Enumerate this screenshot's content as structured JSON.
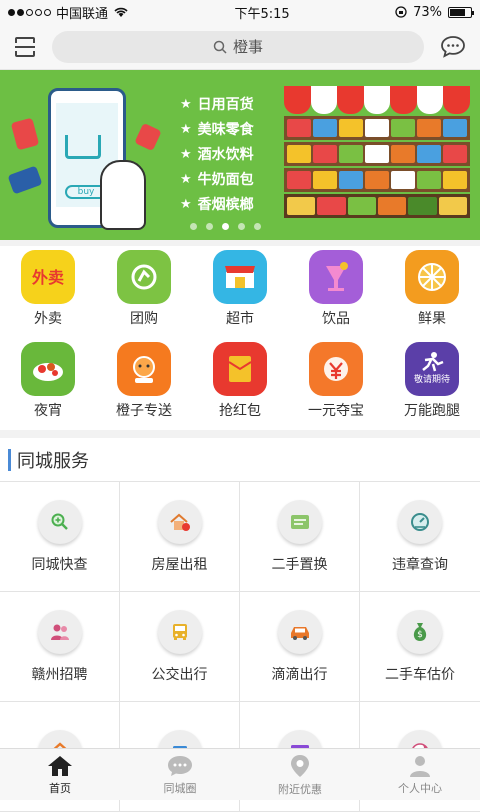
{
  "status": {
    "carrier": "中国联通",
    "time": "下午5:15",
    "battery": "73%"
  },
  "header": {
    "search_placeholder": "橙事"
  },
  "banner": {
    "items": [
      "日用百货",
      "美味零食",
      "酒水饮料",
      "牛奶面包",
      "香烟槟榔"
    ],
    "phone_button": "buy",
    "active_page": 3
  },
  "categories": [
    {
      "label": "外卖",
      "color": "#f6d21b",
      "icon_text": "外卖"
    },
    {
      "label": "团购",
      "color": "#7dc343",
      "icon_text": ""
    },
    {
      "label": "超市",
      "color": "#34b6e4",
      "icon_text": ""
    },
    {
      "label": "饮品",
      "color": "#a45ed8",
      "icon_text": ""
    },
    {
      "label": "鲜果",
      "color": "#f39c1f",
      "icon_text": ""
    },
    {
      "label": "夜宵",
      "color": "#69b83b",
      "icon_text": ""
    },
    {
      "label": "橙子专送",
      "color": "#f57a1f",
      "icon_text": ""
    },
    {
      "label": "抢红包",
      "color": "#e8392f",
      "icon_text": ""
    },
    {
      "label": "一元夺宝",
      "color": "#f4782a",
      "icon_text": ""
    },
    {
      "label": "万能跑腿",
      "color": "#5b3fa8",
      "icon_text": "敬请期待"
    }
  ],
  "services": {
    "title": "同城服务",
    "items": [
      {
        "label": "同城快查",
        "icon": "magnifier-icon",
        "color": "#4caf50"
      },
      {
        "label": "房屋出租",
        "icon": "house-key-icon",
        "color": "#e07a2f"
      },
      {
        "label": "二手置换",
        "icon": "exchange-icon",
        "color": "#5aa03c"
      },
      {
        "label": "违章查询",
        "icon": "speedometer-icon",
        "color": "#3a8d8d"
      },
      {
        "label": "赣州招聘",
        "icon": "people-icon",
        "color": "#d04f7a"
      },
      {
        "label": "公交出行",
        "icon": "bus-icon",
        "color": "#e8b12a"
      },
      {
        "label": "滴滴出行",
        "icon": "car-icon",
        "color": "#e8772a"
      },
      {
        "label": "二手车估价",
        "icon": "money-bag-icon",
        "color": "#4a9a4a"
      },
      {
        "label": "",
        "icon": "home-icon",
        "color": "#e87a2a"
      },
      {
        "label": "",
        "icon": "calendar-icon",
        "color": "#3a8ad6"
      },
      {
        "label": "",
        "icon": "film-icon",
        "color": "#8a4ad6"
      },
      {
        "label": "",
        "icon": "yin-yang-icon",
        "color": "#d04f7a"
      }
    ]
  },
  "tabs": [
    {
      "label": "首页",
      "icon": "home-icon",
      "active": true
    },
    {
      "label": "同城圈",
      "icon": "chat-icon",
      "active": false
    },
    {
      "label": "附近优惠",
      "icon": "location-pin-icon",
      "active": false
    },
    {
      "label": "个人中心",
      "icon": "person-icon",
      "active": false
    }
  ]
}
